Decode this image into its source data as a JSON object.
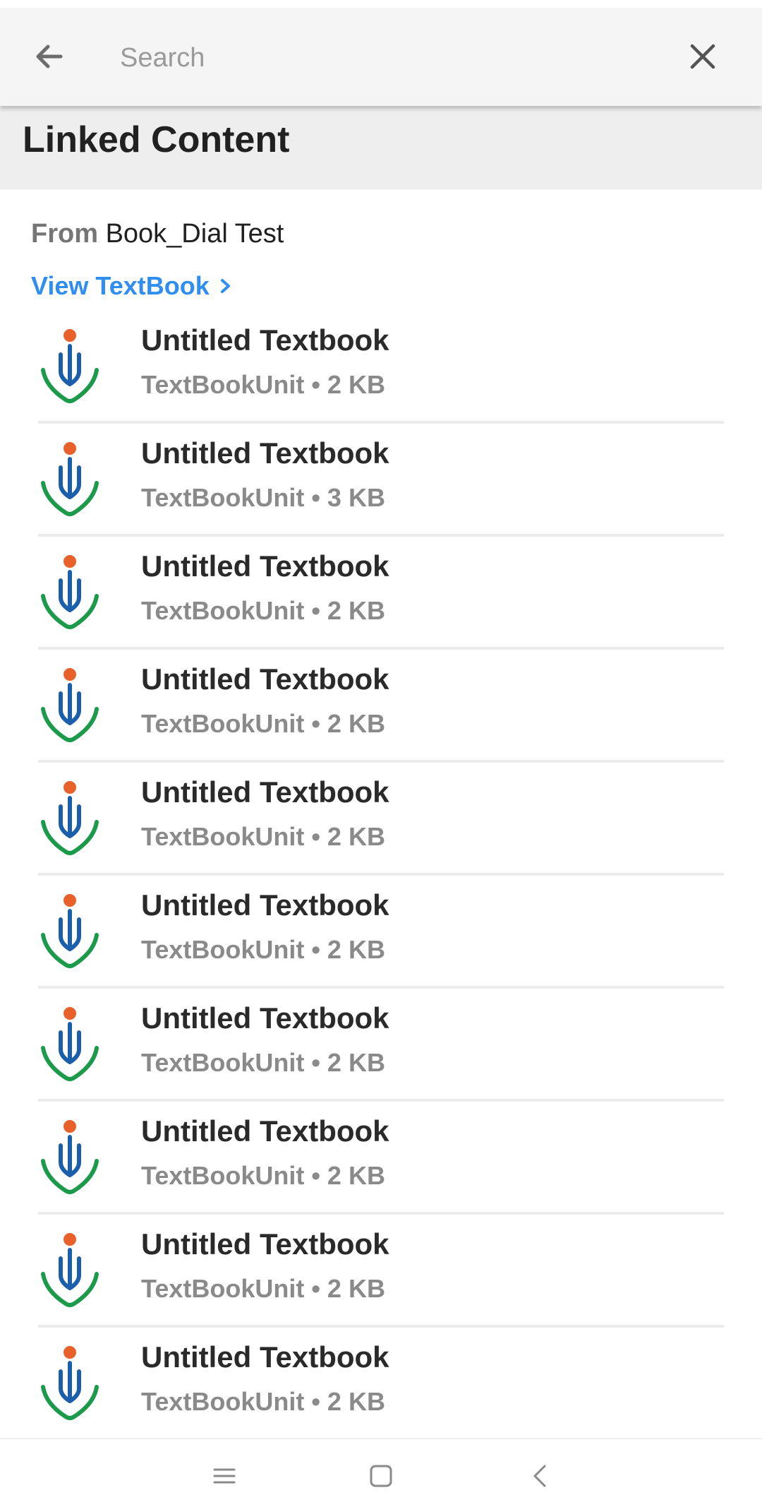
{
  "search": {
    "placeholder": "Search",
    "value": ""
  },
  "header": {
    "title": "Linked Content"
  },
  "source": {
    "from_label": "From",
    "book_name": "Book_Dial Test",
    "view_link": "View TextBook"
  },
  "colors": {
    "link": "#2f8ef0",
    "logo_blue": "#1b5faa",
    "logo_green": "#1a9a4a",
    "logo_dot": "#e8602a"
  },
  "items": [
    {
      "title": "Untitled Textbook",
      "meta": "TextBookUnit • 2 KB"
    },
    {
      "title": "Untitled Textbook",
      "meta": "TextBookUnit • 3 KB"
    },
    {
      "title": "Untitled Textbook",
      "meta": "TextBookUnit • 2 KB"
    },
    {
      "title": "Untitled Textbook",
      "meta": "TextBookUnit • 2 KB"
    },
    {
      "title": "Untitled Textbook",
      "meta": "TextBookUnit • 2 KB"
    },
    {
      "title": "Untitled Textbook",
      "meta": "TextBookUnit • 2 KB"
    },
    {
      "title": "Untitled Textbook",
      "meta": "TextBookUnit • 2 KB"
    },
    {
      "title": "Untitled Textbook",
      "meta": "TextBookUnit • 2 KB"
    },
    {
      "title": "Untitled Textbook",
      "meta": "TextBookUnit • 2 KB"
    },
    {
      "title": "Untitled Textbook",
      "meta": "TextBookUnit • 2 KB"
    }
  ],
  "nav": {
    "icons": [
      "menu-icon",
      "home-icon",
      "back-nav-icon"
    ]
  }
}
